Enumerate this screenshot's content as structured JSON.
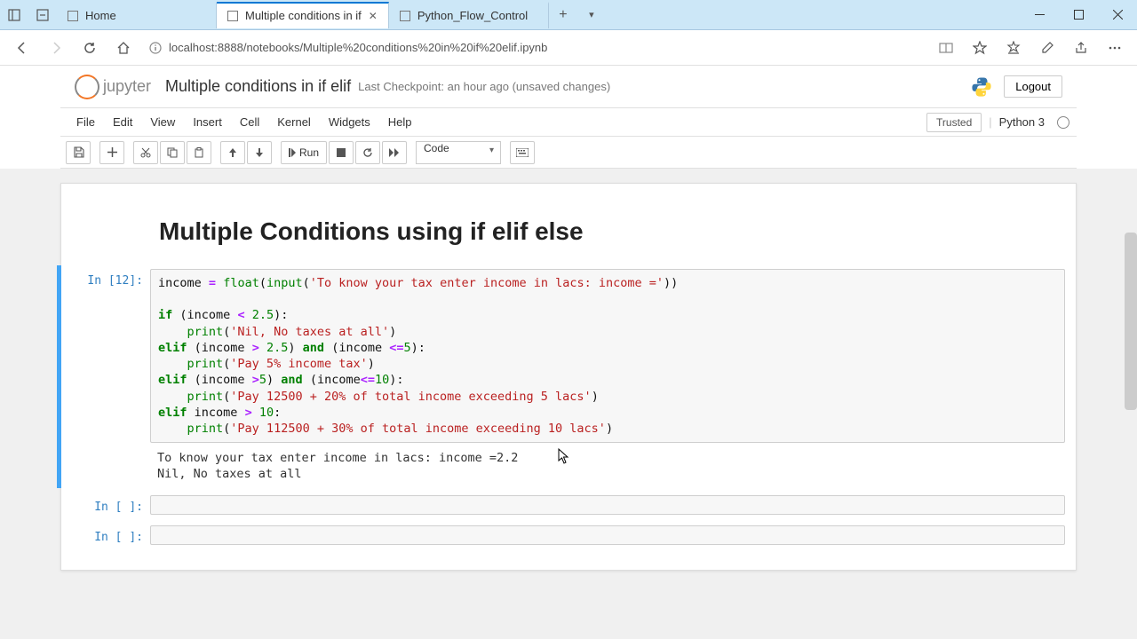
{
  "browser": {
    "tabs": [
      {
        "label": "Home"
      },
      {
        "label": "Multiple conditions in if",
        "active": true
      },
      {
        "label": "Python_Flow_Control"
      }
    ],
    "url": "localhost:8888/notebooks/Multiple%20conditions%20in%20if%20elif.ipynb"
  },
  "jupyter": {
    "logo_text": "jupyter",
    "title": "Multiple conditions in if elif",
    "checkpoint": "Last Checkpoint: an hour ago  (unsaved changes)",
    "logout": "Logout",
    "trusted": "Trusted",
    "kernel": "Python 3",
    "menus": [
      "File",
      "Edit",
      "View",
      "Insert",
      "Cell",
      "Kernel",
      "Widgets",
      "Help"
    ],
    "run_label": "Run",
    "celltype": "Code"
  },
  "notebook": {
    "heading": "Multiple Conditions using if elif else",
    "cells": [
      {
        "prompt": "In [12]:",
        "output": "To know your tax enter income in lacs: income =2.2\nNil, No taxes at all"
      },
      {
        "prompt": "In [ ]:"
      },
      {
        "prompt": "In [ ]:"
      }
    ]
  }
}
